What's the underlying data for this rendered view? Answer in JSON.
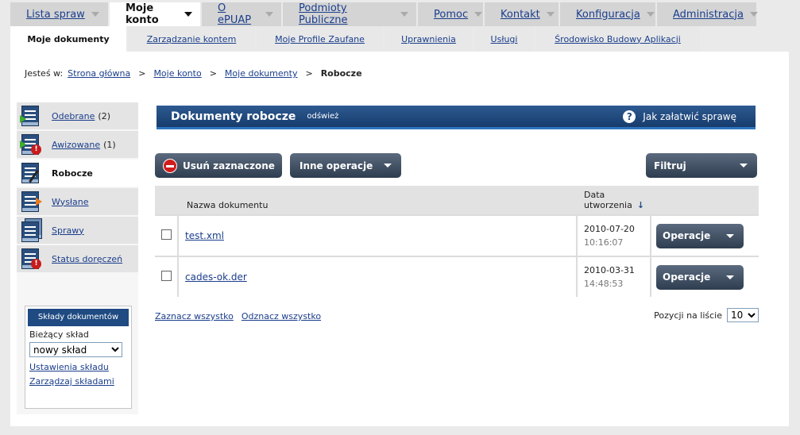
{
  "top_tabs": [
    {
      "label": "Lista spraw"
    },
    {
      "label": "Moje konto"
    },
    {
      "label": "O ePUAP"
    },
    {
      "label": "Podmioty Publiczne"
    },
    {
      "label": "Pomoc"
    },
    {
      "label": "Kontakt"
    },
    {
      "label": "Konfiguracja"
    },
    {
      "label": "Administracja"
    }
  ],
  "sub_tabs": [
    {
      "label": "Moje dokumenty"
    },
    {
      "label": "Zarządzanie kontem"
    },
    {
      "label": "Moje Profile Zaufane"
    },
    {
      "label": "Uprawnienia"
    },
    {
      "label": "Usługi"
    },
    {
      "label": "Środowisko Budowy Aplikacji"
    }
  ],
  "breadcrumb": {
    "prefix": "Jesteś w:",
    "items": [
      "Strona główna",
      "Moje konto",
      "Moje dokumenty"
    ],
    "separator": ">",
    "current": "Robocze"
  },
  "sidebar": {
    "items": [
      {
        "label": "Odebrane",
        "count": "(2)"
      },
      {
        "label": "Awizowane",
        "count": "(1)"
      },
      {
        "label": "Robocze",
        "count": ""
      },
      {
        "label": "Wysłane",
        "count": ""
      },
      {
        "label": "Sprawy",
        "count": ""
      },
      {
        "label": "Status doręczeń",
        "count": ""
      }
    ],
    "sklady": {
      "title": "Składy dokumentów",
      "current_label": "Bieżący skład",
      "selected": "nowy skład",
      "settings_link": "Ustawienia składu",
      "manage_link": "Zarządzaj składami"
    }
  },
  "main": {
    "title": "Dokumenty robocze",
    "refresh": "odśwież",
    "help": "Jak załatwić sprawę",
    "delete_button": "Usuń zaznaczone",
    "other_ops_button": "Inne operacje",
    "filter_button": "Filtruj",
    "table": {
      "col_name": "Nazwa dokumentu",
      "col_date_line1": "Data",
      "col_date_line2": "utworzenia",
      "sort_arrow": "↓",
      "rows": [
        {
          "name": "test.xml",
          "date": "2010-07-20",
          "time": "10:16:07",
          "ops": "Operacje"
        },
        {
          "name": "cades-ok.der",
          "date": "2010-03-31",
          "time": "14:48:53",
          "ops": "Operacje"
        }
      ]
    },
    "select_all": "Zaznacz wszystko",
    "deselect_all": "Odznacz wszystko",
    "per_page_label": "Pozycji na liście",
    "per_page_value": "10"
  },
  "colors": {
    "title_bar": "#1f4a82",
    "button": "#3d4a5c",
    "link": "#1a3e8c",
    "delete_icon": "#d01c1c"
  }
}
